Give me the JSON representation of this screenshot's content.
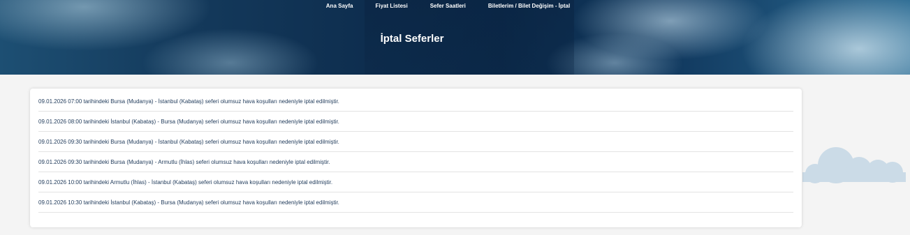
{
  "nav": {
    "items": [
      {
        "label": "Ana Sayfa"
      },
      {
        "label": "Fiyat Listesi"
      },
      {
        "label": "Sefer Saatleri"
      },
      {
        "label": "Biletlerim / Bilet Değişim - İptal"
      }
    ]
  },
  "hero": {
    "title": "İptal Seferler"
  },
  "cancellations": [
    {
      "text": "09.01.2026 07:00 tarihindeki Bursa (Mudanya) - İstanbul (Kabataş) seferi olumsuz hava koşulları nedeniyle iptal edilmiştir."
    },
    {
      "text": "09.01.2026 08:00 tarihindeki İstanbul (Kabataş) - Bursa (Mudanya) seferi olumsuz hava koşulları nedeniyle iptal edilmiştir."
    },
    {
      "text": "09.01.2026 09:30 tarihindeki Bursa (Mudanya) - İstanbul (Kabataş) seferi olumsuz hava koşulları nedeniyle iptal edilmiştir."
    },
    {
      "text": "09.01.2026 09:30 tarihindeki Bursa (Mudanya) - Armutlu (İhlas) seferi olumsuz hava koşulları nedeniyle iptal edilmiştir."
    },
    {
      "text": "09.01.2026 10:00 tarihindeki Armutlu (İhlas) - İstanbul (Kabataş) seferi olumsuz hava koşulları nedeniyle iptal edilmiştir."
    },
    {
      "text": "09.01.2026 10:30 tarihindeki İstanbul (Kabataş) - Bursa (Mudanya) seferi olumsuz hava koşulları nedeniyle iptal edilmiştir."
    }
  ],
  "colors": {
    "hero_dark": "#0e2e4f",
    "row_text": "#1f3a5a",
    "cloud": "#cbdbe7"
  }
}
